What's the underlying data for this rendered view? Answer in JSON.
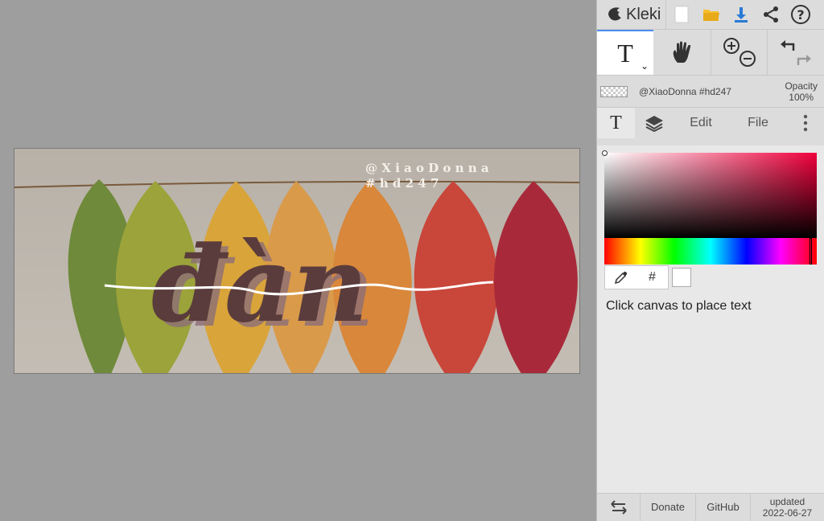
{
  "app": {
    "name": "Kleki"
  },
  "canvas_art": {
    "signature_line1": "@ X i a o D o n n a",
    "signature_line2": "# h d 2 4 7",
    "headline": "đàn"
  },
  "layer": {
    "name": "@XiaoDonna #hd247",
    "opacity_label": "Opacity",
    "opacity_value": "100%"
  },
  "tabs": {
    "edit": "Edit",
    "file": "File"
  },
  "text_tool": {
    "icon_glyph": "T",
    "hex_symbol": "#",
    "hint": "Click canvas to place text"
  },
  "footer": {
    "donate": "Donate",
    "github": "GitHub",
    "updated_label": "updated",
    "updated_date": "2022-06-27"
  },
  "colors": {
    "accent": "#4b8cf0",
    "picker_hue": "#f0003c",
    "text_color": "#ffffff",
    "headline_color": "#5a3c3c"
  }
}
